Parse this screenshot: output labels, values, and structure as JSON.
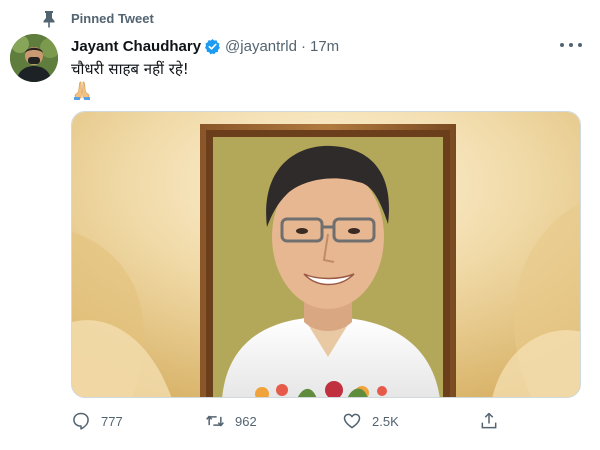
{
  "pinned": {
    "label": "Pinned Tweet",
    "icon": "pin-icon"
  },
  "author": {
    "name": "Jayant Chaudhary",
    "handle": "@jayantrld",
    "verified": true,
    "avatar_icon": "avatar"
  },
  "tweet": {
    "separator": "·",
    "time": "17m",
    "text": "चौधरी साहब नहीं रहे!",
    "emoji_icon": "folded-hands-icon",
    "media": {
      "type": "photo",
      "description_icon": "portrait-photo"
    }
  },
  "actions": {
    "reply": {
      "icon": "reply-icon",
      "count": "777"
    },
    "retweet": {
      "icon": "retweet-icon",
      "count": "962"
    },
    "like": {
      "icon": "like-icon",
      "count": "2.5K"
    },
    "share": {
      "icon": "share-icon"
    }
  },
  "colors": {
    "text": "#0f1419",
    "secondary": "#536471",
    "verified": "#1d9bf0",
    "media_bg": "#e8c990",
    "frame": "#7a4a22"
  }
}
